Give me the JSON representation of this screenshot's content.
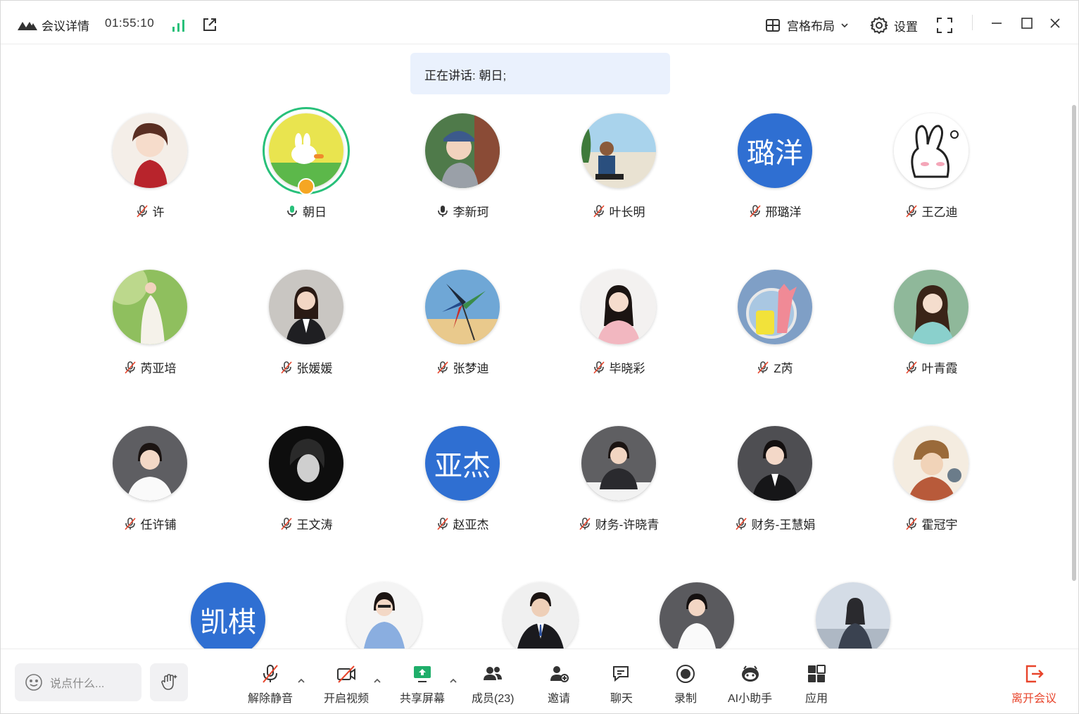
{
  "titlebar": {
    "meeting_detail": "会议详情",
    "timer": "01:55:10",
    "layout_label": "宫格布局",
    "settings_label": "设置"
  },
  "speaking_banner": "正在讲话: 朝日;",
  "participants": [
    {
      "name": "许",
      "mic": "muted"
    },
    {
      "name": "朝日",
      "mic": "speaking"
    },
    {
      "name": "李新珂",
      "mic": "on"
    },
    {
      "name": "叶长明",
      "mic": "muted"
    },
    {
      "name": "邢璐洋",
      "mic": "muted",
      "initials": "璐洋"
    },
    {
      "name": "王乙迪",
      "mic": "muted"
    },
    {
      "name": "芮亚培",
      "mic": "muted"
    },
    {
      "name": "张媛媛",
      "mic": "muted"
    },
    {
      "name": "张梦迪",
      "mic": "muted"
    },
    {
      "name": "毕晓彩",
      "mic": "muted"
    },
    {
      "name": "Z芮",
      "mic": "muted"
    },
    {
      "name": "叶青霞",
      "mic": "muted"
    },
    {
      "name": "任许铺",
      "mic": "muted"
    },
    {
      "name": "王文涛",
      "mic": "muted"
    },
    {
      "name": "赵亚杰",
      "mic": "muted",
      "initials": "亚杰"
    },
    {
      "name": "财务-许晓青",
      "mic": "muted"
    },
    {
      "name": "财务-王慧娟",
      "mic": "muted"
    },
    {
      "name": "霍冠宇",
      "mic": "muted"
    },
    {
      "name": "",
      "initials": "凯棋"
    },
    {
      "name": ""
    },
    {
      "name": ""
    },
    {
      "name": ""
    },
    {
      "name": ""
    }
  ],
  "toolbar": {
    "chat_placeholder": "说点什么...",
    "unmute": "解除静音",
    "start_video": "开启视频",
    "share_screen": "共享屏幕",
    "members": "成员(23)",
    "invite": "邀请",
    "chat": "聊天",
    "record": "录制",
    "ai_assistant": "AI小助手",
    "apps": "应用",
    "leave": "离开会议"
  },
  "colors": {
    "accent_blue": "#2f6fd2",
    "speaking_green": "#28c07a",
    "leave_red": "#e8442b",
    "banner_bg": "#eaf1fd"
  }
}
